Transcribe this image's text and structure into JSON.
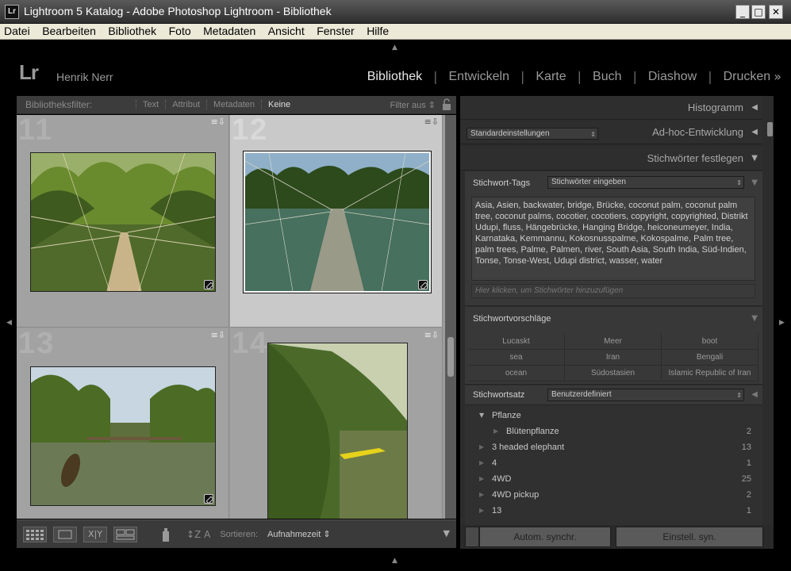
{
  "window": {
    "title": "Lightroom 5 Katalog - Adobe Photoshop Lightroom - Bibliothek",
    "app_icon": "Lr",
    "controls": [
      "minimize",
      "maximize",
      "close"
    ]
  },
  "menu": [
    "Datei",
    "Bearbeiten",
    "Bibliothek",
    "Foto",
    "Metadaten",
    "Ansicht",
    "Fenster",
    "Hilfe"
  ],
  "identity": {
    "logo": "Lr",
    "user": "Henrik Nerr"
  },
  "modules": {
    "items": [
      "Bibliothek",
      "Entwickeln",
      "Karte",
      "Buch",
      "Diashow",
      "Drucken"
    ],
    "active": "Bibliothek",
    "more_icon": "double-chevron-right-icon"
  },
  "filterbar": {
    "label": "Bibliotheksfilter:",
    "tabs": [
      "Text",
      "Attribut",
      "Metadaten",
      "Keine"
    ],
    "active_tab": "Keine",
    "preset": "Filter aus"
  },
  "grid": {
    "cells": [
      {
        "number": "11",
        "selected": false
      },
      {
        "number": "12",
        "selected": true
      },
      {
        "number": "13",
        "selected": false
      },
      {
        "number": "14",
        "selected": false
      }
    ]
  },
  "toolbar": {
    "sort_label": "Sortieren:",
    "sort_value": "Aufnahmezeit",
    "buttons": [
      "grid-view-icon",
      "loupe-view-icon",
      "compare-view-icon",
      "survey-view-icon",
      "spray-can-icon",
      "sort-direction-icon"
    ]
  },
  "panel": {
    "histogram": "Histogramm",
    "quick_develop": {
      "title": "Ad-hoc-Entwicklung",
      "preset": "Standardeinstellungen"
    },
    "keywording": {
      "title": "Stichwörter festlegen",
      "tags_label": "Stichwort-Tags",
      "tags_mode": "Stichwörter eingeben",
      "keywords": "Asia, Asien, backwater, bridge, Brücke, coconut palm, coconut palm tree, coconut palms, cocotier, cocotiers, copyright, copyrighted, Distrikt Udupi, fluss, Hängebrücke, Hanging Bridge, heiconeumeyer, India, Karnataka, Kemmannu, Kokosnusspalme, Kokospalme, Palm tree, palm trees, Palme, Palmen, river, South Asia, South India, Süd-Indien, Tonse, Tonse-West, Udupi district, wasser, water",
      "add_placeholder": "Hier klicken, um Stichwörter hinzuzufügen",
      "suggestions_title": "Stichwortvorschläge",
      "suggestions": [
        "Lucaskt",
        "Meer",
        "boot",
        "sea",
        "Iran",
        "Bengali",
        "ocean",
        "Südostasien",
        "Islamic Republic of Iran"
      ],
      "set_label": "Stichwortsatz",
      "set_value": "Benutzerdefiniert"
    },
    "keyword_list": [
      {
        "name": "Pflanze",
        "count": "",
        "level": 0,
        "expanded": true
      },
      {
        "name": "Blütenpflanze",
        "count": "2",
        "level": 1,
        "expanded": false
      },
      {
        "name": "3 headed elephant",
        "count": "13",
        "level": 0,
        "expanded": false
      },
      {
        "name": "4",
        "count": "1",
        "level": 0,
        "expanded": false
      },
      {
        "name": "4WD",
        "count": "25",
        "level": 0,
        "expanded": false
      },
      {
        "name": "4WD pickup",
        "count": "2",
        "level": 0,
        "expanded": false
      },
      {
        "name": "13",
        "count": "1",
        "level": 0,
        "expanded": false
      }
    ],
    "sync": {
      "auto": "Autom. synchr.",
      "settings": "Einstell. syn."
    }
  }
}
